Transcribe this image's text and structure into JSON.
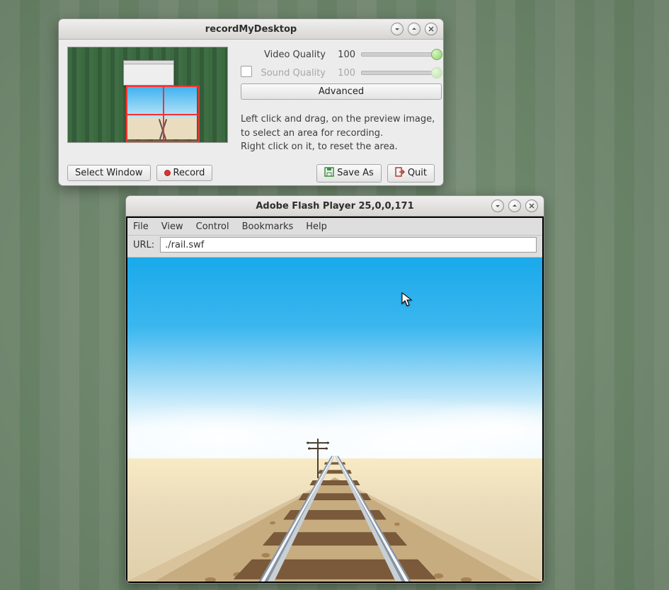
{
  "window1": {
    "title": "recordMyDesktop",
    "video_quality_label": "Video Quality",
    "video_quality_value": "100",
    "sound_quality_label": "Sound Quality",
    "sound_quality_value": "100",
    "sound_enabled": false,
    "advanced_label": "Advanced",
    "hint_line1": "Left click and drag, on the preview image,",
    "hint_line2": "to select an area for recording.",
    "hint_line3": "Right click on it, to reset the area.",
    "select_window_label": "Select Window",
    "record_label": "Record",
    "save_as_label": "Save As",
    "quit_label": "Quit"
  },
  "window2": {
    "title": "Adobe Flash Player 25,0,0,171",
    "menu": {
      "file": "File",
      "view": "View",
      "control": "Control",
      "bookmarks": "Bookmarks",
      "help": "Help"
    },
    "url_label": "URL:",
    "url_value": "./rail.swf"
  }
}
